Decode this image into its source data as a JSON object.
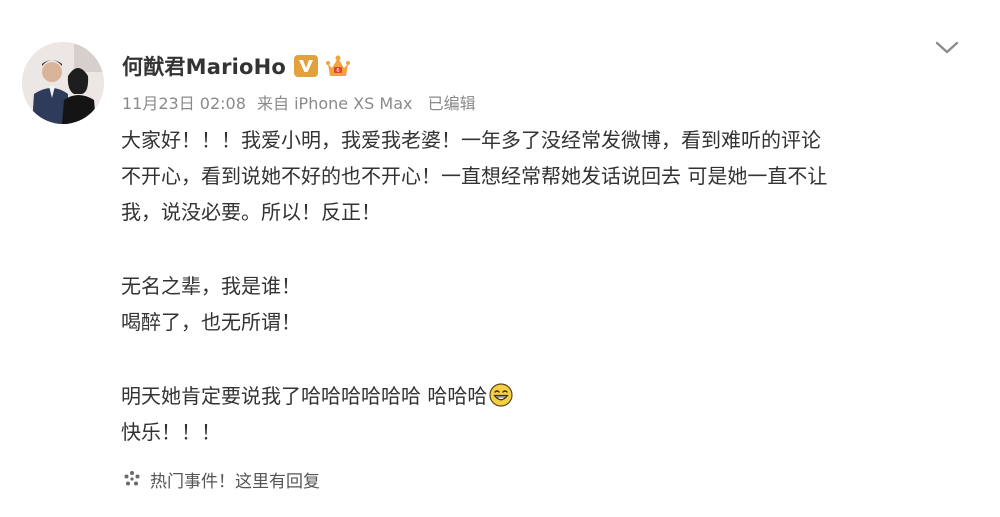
{
  "post": {
    "username": "何猷君MarioHo",
    "verified_badge_icon": "verified-v-icon",
    "member_badge_icon": "crown-member-icon",
    "date": "11月23日 02:08",
    "source": "来自 iPhone XS Max",
    "edited_label": "已编辑",
    "menu_icon": "chevron-down-icon",
    "lines": [
      "大家好！！！我爱小明，我爱我老婆！一年多了没经常发微博，看到难听的评论",
      "不开心，看到说她不好的也不开心！一直想经常帮她发话说回去 可是她一直不让",
      "我，说没必要。所以！反正！"
    ],
    "lines2": [
      "无名之辈，我是谁！",
      "喝醉了，也无所谓！"
    ],
    "line3": "明天她肯定要说我了哈哈哈哈哈哈 哈哈哈",
    "emoji_icon": "grinning-face-icon",
    "line4": "快乐！！！",
    "footer": {
      "icon": "sparkle-icon",
      "text": "热门事件！这里有回复"
    }
  },
  "colors": {
    "primary_text": "#333333",
    "meta_text": "#8a8a8a",
    "verified_badge": "#e3a13b",
    "background": "#ffffff"
  }
}
